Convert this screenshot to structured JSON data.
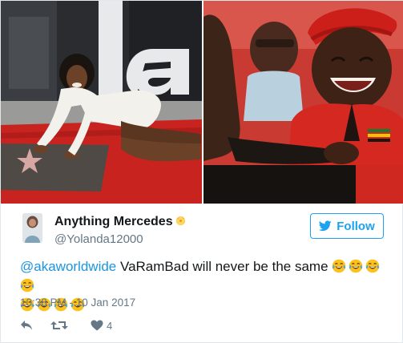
{
  "tweet": {
    "author_name": "Anything Mercedes",
    "handle": "@Yolanda12000",
    "follow_label": "Follow",
    "mention": "@akaworldwide",
    "text_line": " VaRamBad will never be the same ",
    "timestamp": "10:38 PM - 10 Jan 2017",
    "like_count": "4",
    "emoji_count_line1": 4,
    "emoji_count_line2": 4
  },
  "icons": {
    "author_emoji": "hibiscus-flower",
    "tweet_emoji": "face-with-tears-of-joy",
    "follow_icon": "twitter-bird",
    "reply_icon": "reply-arrow",
    "retweet_icon": "retweet-arrows",
    "like_icon": "heart"
  },
  "colors": {
    "brand_blue": "#1da1f2",
    "mention_blue": "#1b95e0",
    "secondary_text": "#657786",
    "action_gray": "#657786"
  }
}
